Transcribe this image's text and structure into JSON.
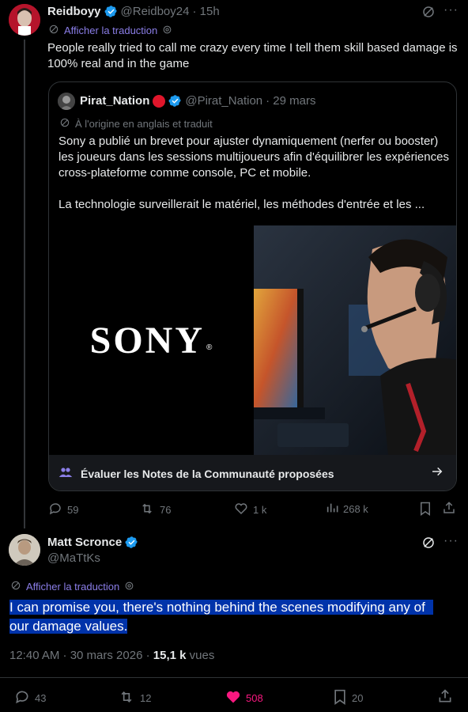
{
  "tweet1": {
    "name": "Reidboyy",
    "handle": "@Reidboy24",
    "time": "· 15h",
    "translate_label": "Afficher la traduction",
    "text": "People really tried to call me crazy every time I tell them skill based damage is 100% real and in the game",
    "stats": {
      "replies": "59",
      "reposts": "76",
      "likes": "1 k",
      "views": "268 k"
    }
  },
  "quote": {
    "name": "Pirat_Nation",
    "handle": "@Pirat_Nation",
    "time": "· 29 mars",
    "origin_label": "À l'origine en anglais et traduit",
    "text1": "Sony a publié un brevet pour ajuster dynamiquement (nerfer ou booster) les joueurs dans les sessions multijoueurs afin d'équilibrer les expériences cross-plateforme comme console, PC et mobile.",
    "text2": "La technologie surveillerait le matériel, les méthodes d'entrée et les ...",
    "sony_logo": "SONY",
    "community_notes": "Évaluer les Notes de la Communauté proposées"
  },
  "tweet2": {
    "name": "Matt Scronce",
    "handle": "@MaTtKs",
    "translate_label": "Afficher la traduction",
    "text_line1": "I can promise you, there's nothing behind the scenes modifying any of",
    "text_line2": "our damage values.",
    "timestamp": "12:40 AM · 30 mars 2026 · ",
    "views_count": "15,1 k",
    "views_label": " vues",
    "stats": {
      "replies": "43",
      "reposts": "12",
      "likes": "508",
      "bookmarks": "20"
    }
  },
  "colors": {
    "accent": "#1d9bf0",
    "like": "#f91880",
    "highlight": "#0033aa"
  }
}
